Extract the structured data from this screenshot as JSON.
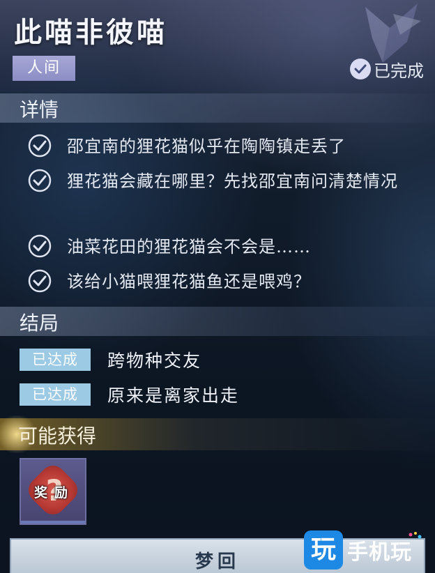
{
  "quest": {
    "title": "此喵非彼喵",
    "realm_tag": "人间",
    "status": "已完成"
  },
  "details": {
    "heading": "详情",
    "tasks": [
      {
        "text": "邵宜南的狸花猫似乎在陶陶镇走丢了",
        "done": true
      },
      {
        "text": "狸花猫会藏在哪里？先找邵宜南问清楚情况",
        "done": true
      },
      {
        "text": "油菜花田的狸花猫会不会是……",
        "done": true
      },
      {
        "text": "该给小猫喂狸花猫鱼还是喂鸡？",
        "done": true
      }
    ]
  },
  "endings": {
    "heading": "结局",
    "items": [
      {
        "badge": "已达成",
        "text": "跨物种交友"
      },
      {
        "badge": "已达成",
        "text": "原来是离家出走"
      }
    ]
  },
  "rewards": {
    "heading": "可能获得",
    "items": [
      {
        "label": "奖励",
        "icon": "mystery-reward-icon"
      }
    ]
  },
  "actions": {
    "dream_button": "梦回"
  },
  "watermark": {
    "logo": "玩",
    "text": "手机玩"
  },
  "colors": {
    "realm_tag": "#9a9bcd",
    "achieved_badge": "#9cc9e4",
    "reward_band": "#967828"
  }
}
